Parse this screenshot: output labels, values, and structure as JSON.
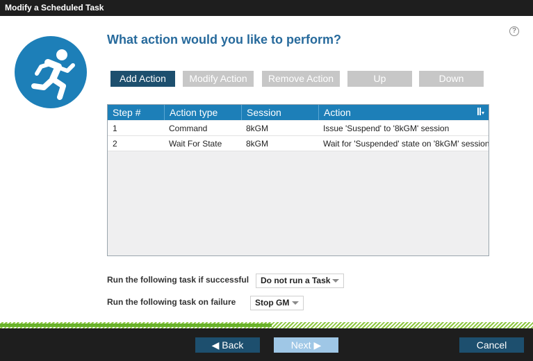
{
  "window": {
    "title": "Modify a Scheduled Task"
  },
  "help": {
    "glyph": "?"
  },
  "heading": "What action would you like to perform?",
  "toolbar": {
    "add_action": "Add Action",
    "modify_action": "Modify Action",
    "remove_action": "Remove Action",
    "up": "Up",
    "down": "Down"
  },
  "table": {
    "columns": [
      "Step #",
      "Action type",
      "Session",
      "Action"
    ],
    "rows": [
      {
        "step": "1",
        "action_type": "Command",
        "session": "8kGM",
        "action": "Issue 'Suspend' to '8kGM' session"
      },
      {
        "step": "2",
        "action_type": "Wait For State",
        "session": "8kGM",
        "action": "Wait for 'Suspended' state on '8kGM' session"
      }
    ]
  },
  "on_success": {
    "label": "Run the following task if successful",
    "selected": "Do not run a Task"
  },
  "on_failure": {
    "label": "Run the following task on failure",
    "selected": "Stop GM"
  },
  "progress": {
    "fraction": 0.51
  },
  "footer": {
    "back": "◀ Back",
    "next": "Next ▶",
    "cancel": "Cancel"
  },
  "colors": {
    "accent": "#1d7fb8",
    "primary_button": "#1d4f6e",
    "heading": "#276a9c",
    "progress": "#69b22a",
    "disabled_button": "#c7c7c7"
  },
  "icons": {
    "avatar": "running-person-icon",
    "sort": "column-chooser-icon"
  }
}
